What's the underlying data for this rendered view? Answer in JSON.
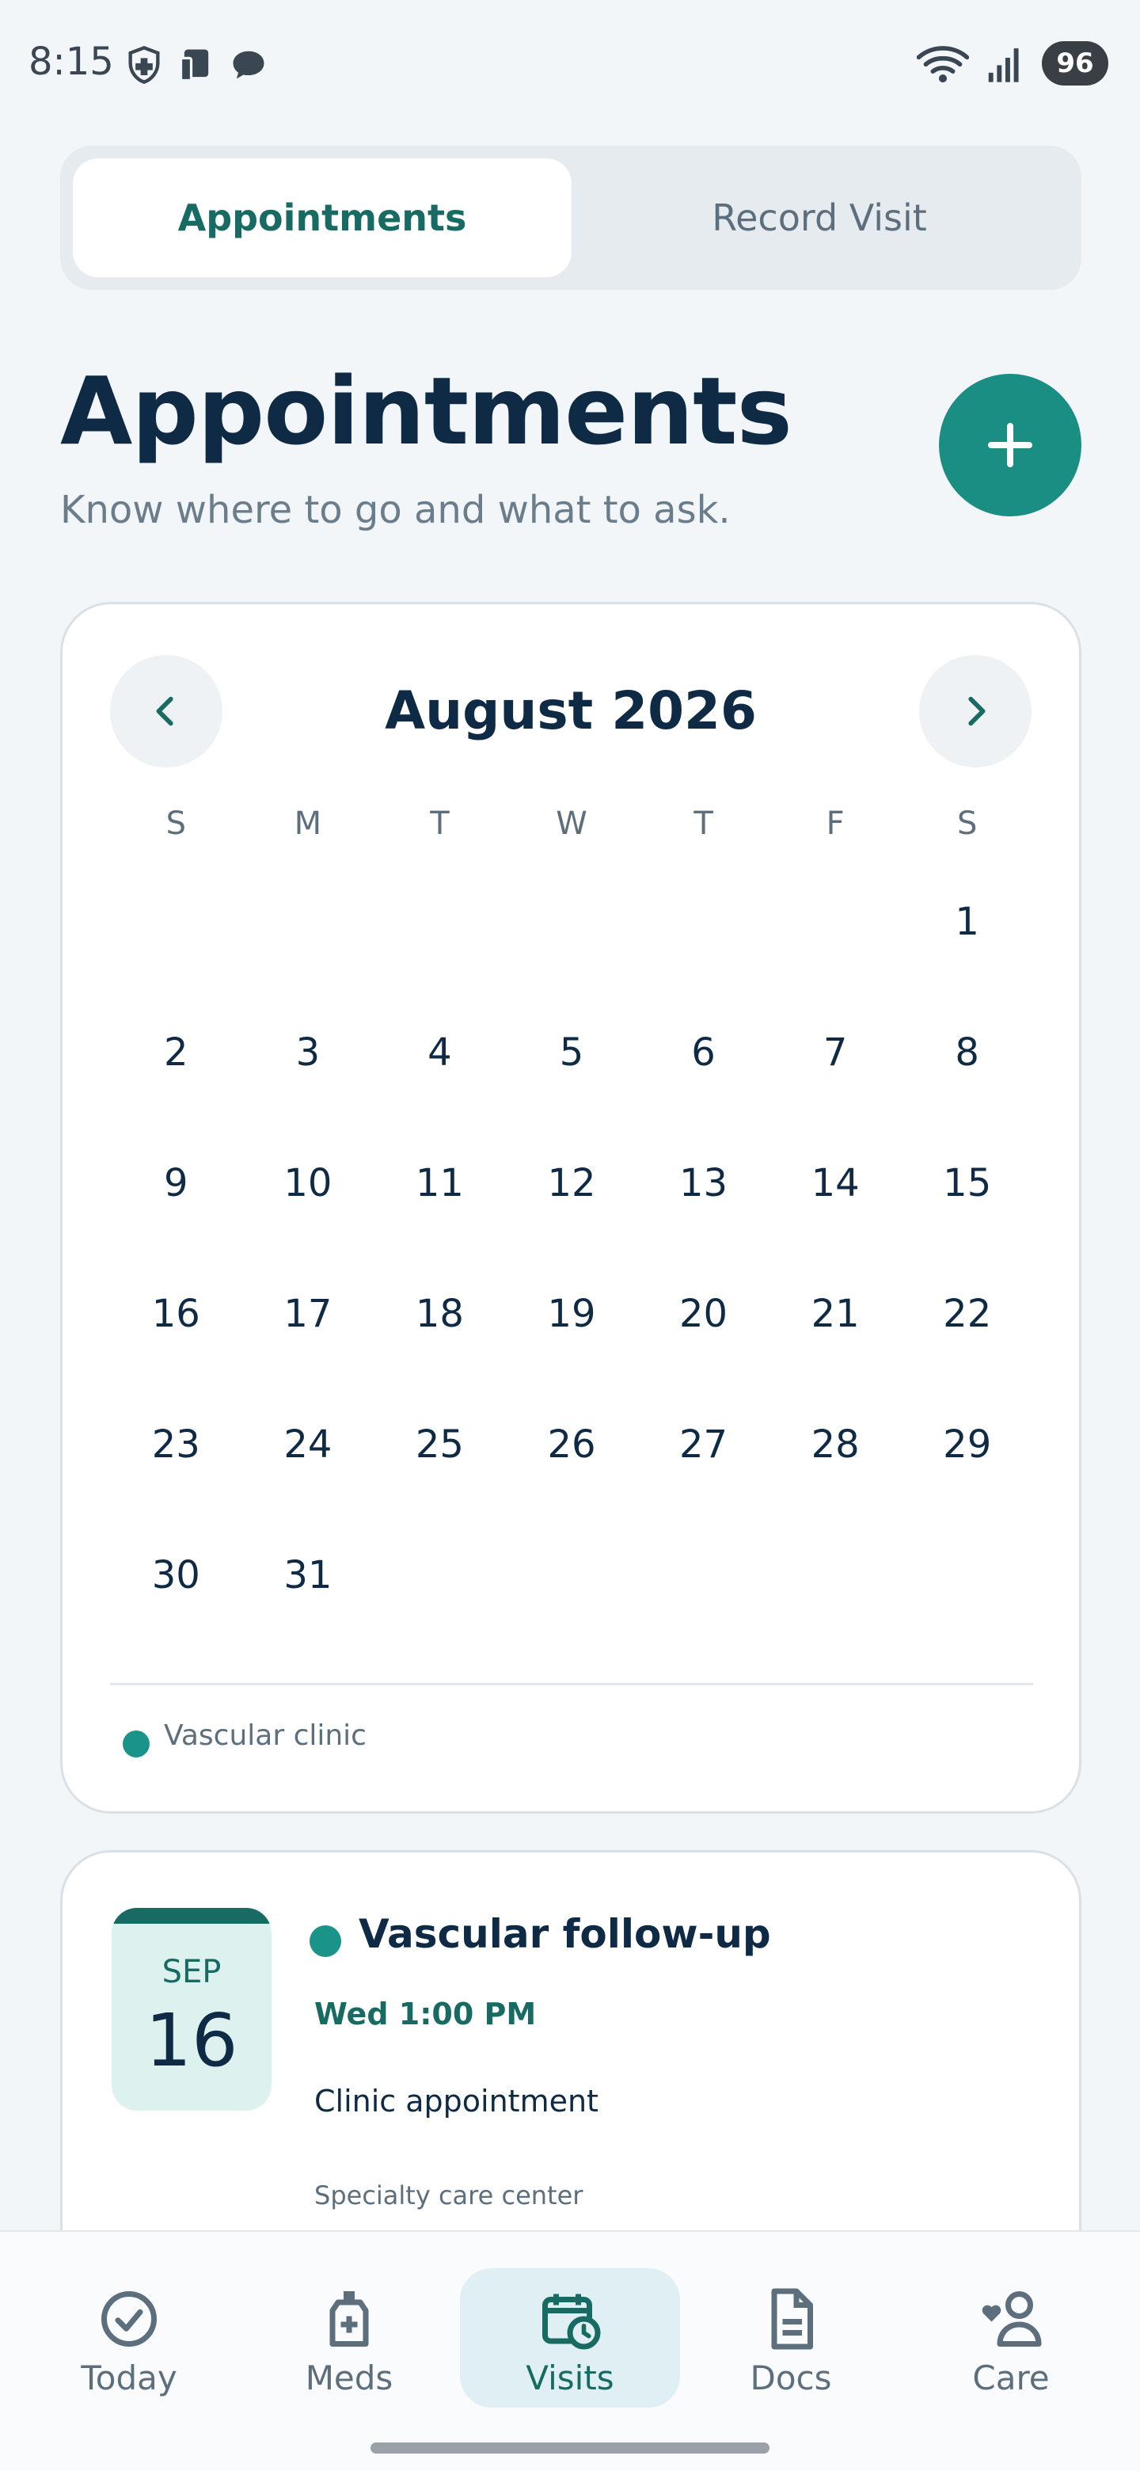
{
  "status_bar": {
    "time": "8:15",
    "battery": "96",
    "left_icons": [
      "medical-app-icon",
      "device-icon",
      "chat-bubble-icon"
    ],
    "right_icons": [
      "wifi-icon",
      "signal-icon"
    ]
  },
  "tabs": [
    {
      "label": "Appointments",
      "active": true
    },
    {
      "label": "Record Visit",
      "active": false
    }
  ],
  "header": {
    "title": "Appointments",
    "subtitle": "Know where to go and what to ask.",
    "add_icon": "plus-icon"
  },
  "calendar": {
    "month_title": "August 2026",
    "weekdays": [
      "S",
      "M",
      "T",
      "W",
      "T",
      "F",
      "S"
    ],
    "leading_blanks": 6,
    "days": [
      "1",
      "2",
      "3",
      "4",
      "5",
      "6",
      "7",
      "8",
      "9",
      "10",
      "11",
      "12",
      "13",
      "14",
      "15",
      "16",
      "17",
      "18",
      "19",
      "20",
      "21",
      "22",
      "23",
      "24",
      "25",
      "26",
      "27",
      "28",
      "29",
      "30",
      "31"
    ],
    "legend_label": "Vascular clinic"
  },
  "appointment": {
    "month": "SEP",
    "day": "16",
    "title": "Vascular follow-up",
    "time": "Wed 1:00 PM",
    "type": "Clinic appointment",
    "location": "Specialty care center"
  },
  "bottom_nav": [
    {
      "label": "Today",
      "icon": "check-circle-icon",
      "active": false
    },
    {
      "label": "Meds",
      "icon": "pill-bottle-icon",
      "active": false
    },
    {
      "label": "Visits",
      "icon": "calendar-clock-icon",
      "active": true
    },
    {
      "label": "Docs",
      "icon": "document-icon",
      "active": false
    },
    {
      "label": "Care",
      "icon": "care-person-icon",
      "active": false
    }
  ],
  "colors": {
    "accent": "#1a8e83",
    "accent_dark": "#176b62",
    "title": "#0f2a44",
    "muted": "#5d6f7c"
  }
}
